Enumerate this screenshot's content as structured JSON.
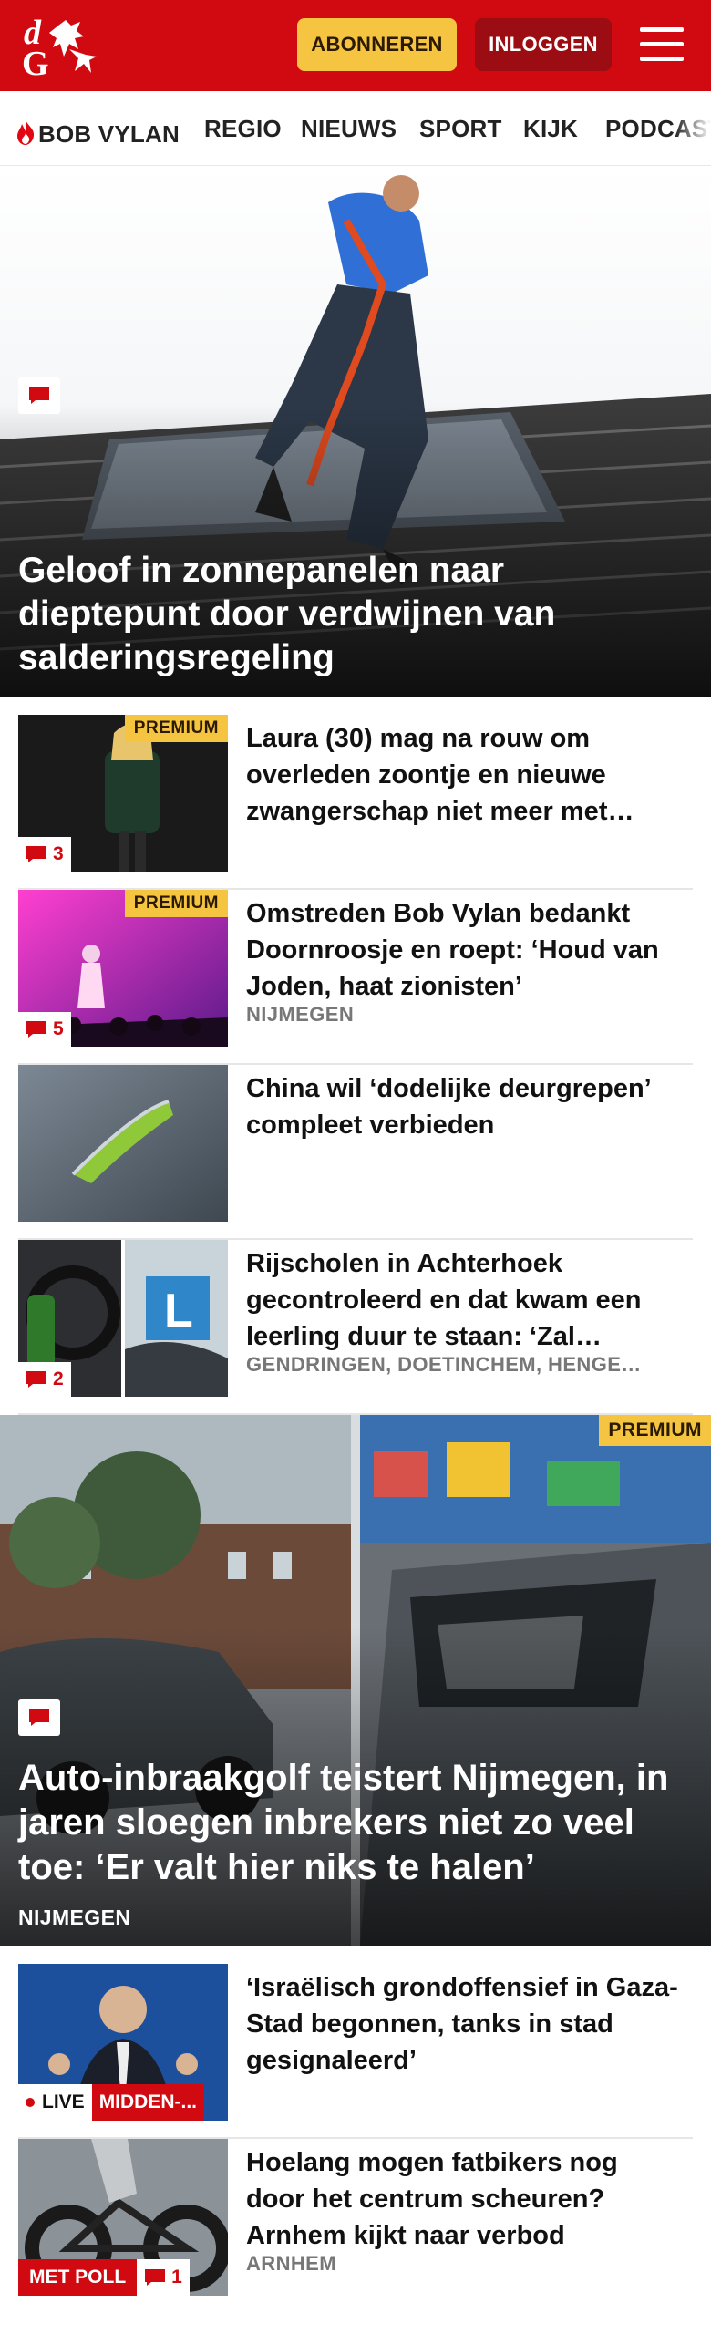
{
  "header": {
    "logo_text": "dG",
    "subscribe_label": "ABONNEREN",
    "login_label": "INLOGGEN",
    "menu_icon": "hamburger-icon",
    "brand_color": "#d10a11"
  },
  "nav": {
    "items": [
      {
        "label": "BOB VYLAN",
        "icon": "flame-icon"
      },
      {
        "label": "REGIO"
      },
      {
        "label": "NIEUWS"
      },
      {
        "label": "SPORT"
      },
      {
        "label": "KIJK"
      },
      {
        "label": "PODCAST"
      }
    ]
  },
  "hero": {
    "title": "Geloof in zonnepanelen naar dieptepunt door verdwijnen van salderingsregeling",
    "badge_icon": "comment-icon"
  },
  "articles": [
    {
      "title": "Laura (30) mag na rouw om overleden zoontje en nieuwe zwangerschap niet meer met…",
      "premium": "PREMIUM",
      "comments": "3"
    },
    {
      "title": "Omstreden Bob Vylan bedankt Doornroosje en roept: ‘Houd van Joden, haat zionisten’",
      "premium": "PREMIUM",
      "comments": "5",
      "meta": "NIJMEGEN"
    },
    {
      "title": "China wil ‘dodelijke deurgrepen’ compleet verbieden"
    },
    {
      "title": "Rijscholen in Achterhoek gecontroleerd en dat kwam een leerling duur te staan: ‘Zal…",
      "comments": "2",
      "meta": "GENDRINGEN, DOETINCHEM, HENGE…"
    }
  ],
  "feature": {
    "title": "Auto-inbraakgolf teistert Nijmegen, in jaren sloegen inbrekers niet zo veel toe: ‘Er valt hier niks te halen’",
    "meta": "NIJMEGEN",
    "premium": "PREMIUM"
  },
  "articles2": [
    {
      "title": "‘Israëlisch grondoffensief in Gaza-Stad begonnen, tanks in stad gesignaleerd’",
      "live": "LIVE",
      "live_topic": "MIDDEN-..."
    },
    {
      "title": "Hoelang mogen fatbikers nog door het centrum scheuren? Arnhem kijkt naar verbod",
      "poll": "MET POLL",
      "comments": "1",
      "meta": "ARNHEM"
    }
  ]
}
